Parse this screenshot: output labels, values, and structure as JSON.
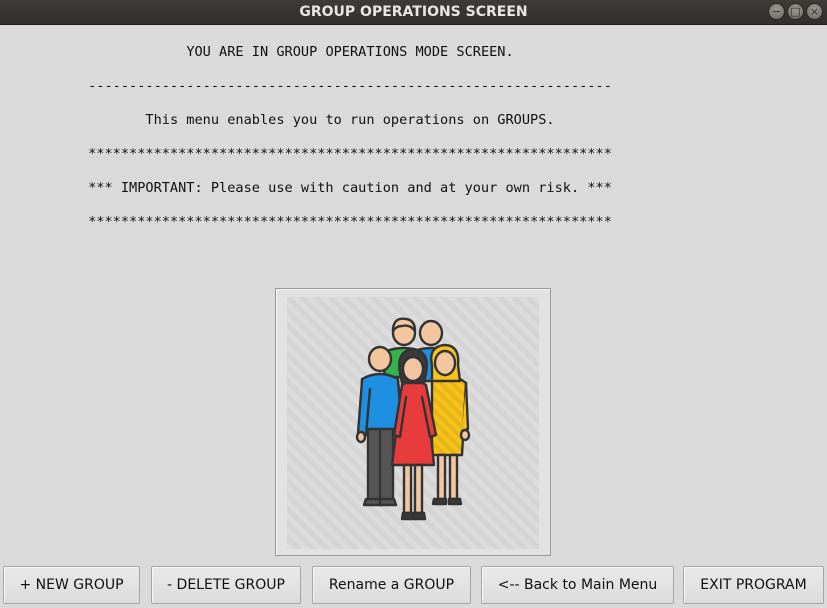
{
  "window": {
    "title": "GROUP OPERATIONS SCREEN",
    "minimize_glyph": "−",
    "maximize_glyph": "□",
    "close_glyph": "×"
  },
  "body": {
    "heading": "YOU ARE IN GROUP OPERATIONS MODE SCREEN.",
    "dash_rule": "----------------------------------------------------------------",
    "description": "This menu enables you to run operations on GROUPS.",
    "star_rule_top": "****************************************************************",
    "warning": "*** IMPORTANT: Please use with caution and at your own risk. ***",
    "star_rule_bottom": "****************************************************************"
  },
  "illustration": {
    "icon": "group-of-people-icon",
    "colors": {
      "green": "#33b34a",
      "blue": "#1e8fe1",
      "red": "#e83b3b",
      "yellow": "#f7c31a",
      "skin": "#f2c7a0",
      "hair": "#3a3a3a",
      "pants": "#555555",
      "outline": "#333333"
    }
  },
  "buttons": {
    "new_group": "+ NEW GROUP",
    "delete_group": "- DELETE GROUP",
    "rename_group": "Rename a GROUP",
    "back_to_main": "<-- Back to Main Menu",
    "exit_program": "EXIT PROGRAM"
  }
}
